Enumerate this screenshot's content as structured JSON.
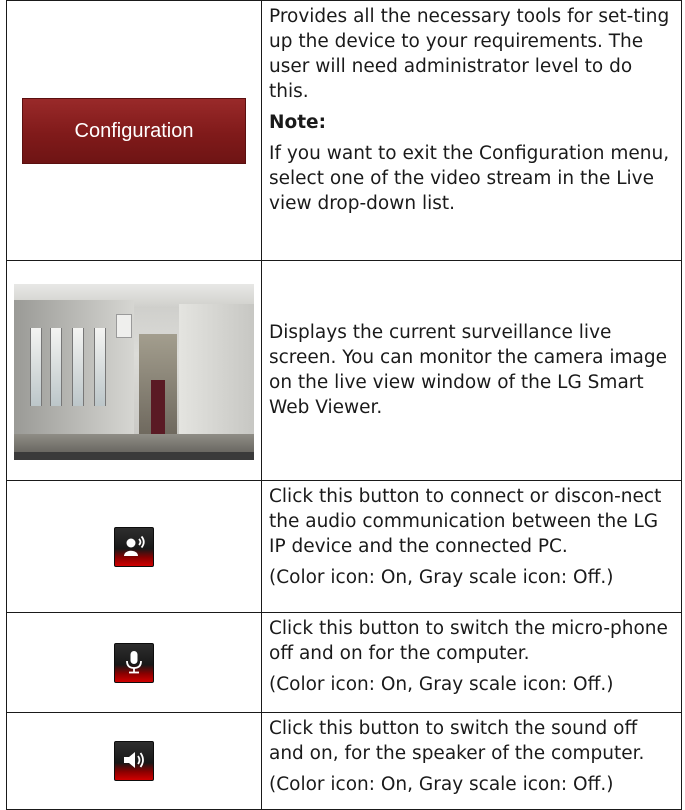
{
  "rows": [
    {
      "icon": "configuration-button",
      "button_label": "Configuration",
      "paragraphs": [
        "Provides all the necessary tools for set-ting up the device to your requirements. The user will need administrator level to do this."
      ],
      "note_label": "Note:",
      "note_text": "If you want to exit the Configuration menu, select one of the video stream in the Live view drop-down list."
    },
    {
      "icon": "live-view-image",
      "paragraphs": [
        "Displays the current surveillance live screen. You can monitor the camera image on the live view window of the LG Smart Web Viewer."
      ]
    },
    {
      "icon": "audio-communication-icon",
      "paragraphs": [
        "Click this button to connect or discon-nect the audio communication between the LG IP device and the connected PC.",
        "(Color icon: On, Gray scale icon: Off.)"
      ]
    },
    {
      "icon": "microphone-icon",
      "paragraphs": [
        "Click this button to switch the micro-phone off and on for the computer.",
        "(Color icon: On, Gray scale icon: Off.)"
      ]
    },
    {
      "icon": "speaker-icon",
      "paragraphs": [
        "Click this button to switch the sound off and on, for the speaker of the computer.",
        "(Color icon: On, Gray scale icon: Off.)"
      ]
    }
  ],
  "colors": {
    "config_button": "#851c1c",
    "icon_accent": "#d00000",
    "border": "#1a1a1a"
  }
}
